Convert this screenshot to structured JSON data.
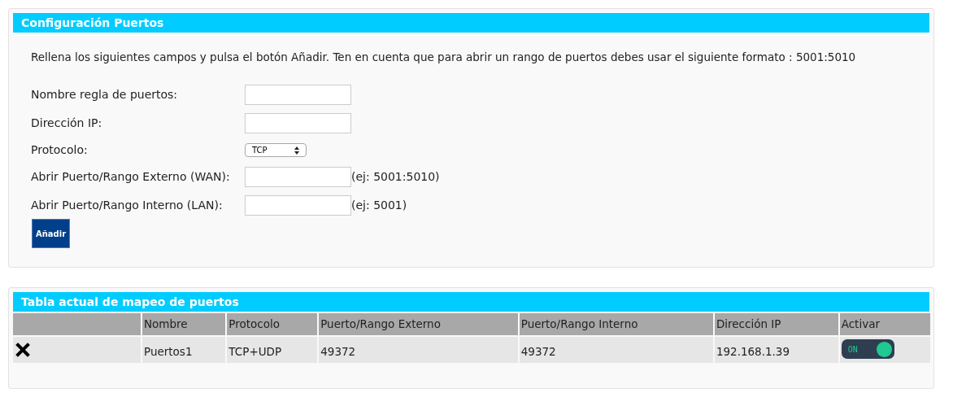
{
  "config": {
    "title": "Configuración Puertos",
    "intro": "Rellena los siguientes campos y pulsa el botón Añadir. Ten en cuenta que para abrir un rango de puertos debes usar el siguiente formato : 5001:5010",
    "fields": [
      {
        "kind": "text",
        "label": "Nombre regla de puertos:"
      },
      {
        "kind": "text",
        "label": "Dirección IP:"
      },
      {
        "kind": "select",
        "label": "Protocolo:",
        "value": "TCP"
      },
      {
        "kind": "text",
        "label": "Abrir Puerto/Rango Externo (WAN):",
        "hint": "(ej: 5001:5010)"
      },
      {
        "kind": "text",
        "label": "Abrir Puerto/Rango Interno (LAN):",
        "hint": "(ej: 5001)"
      }
    ],
    "button": "Añadir"
  },
  "table": {
    "title": "Tabla actual de mapeo de puertos",
    "columns": [
      "Nombre",
      "Protocolo",
      "Puerto/Rango Externo",
      "Puerto/Rango Interno",
      "Dirección IP",
      "Activar"
    ],
    "rows": [
      {
        "name": "Puertos1",
        "protocol": "TCP+UDP",
        "external": "49372",
        "internal": "49372",
        "ip": "192.168.1.39",
        "toggle_label": "ON",
        "on": true
      }
    ]
  }
}
